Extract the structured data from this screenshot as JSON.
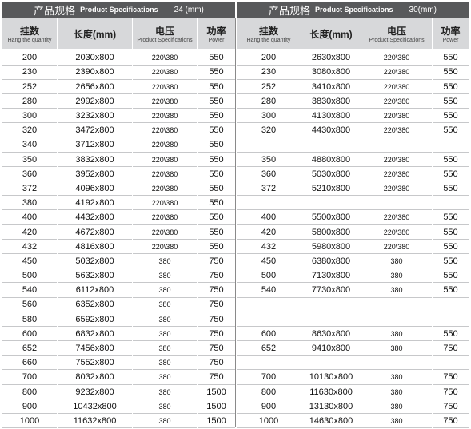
{
  "left": {
    "title_cn": "产品规格",
    "title_en": "Product Specifications",
    "title_size": "24 (mm)",
    "headers": [
      {
        "main": "挂数",
        "sub": "Hang the quantity"
      },
      {
        "main": "长度(mm)",
        "sub": ""
      },
      {
        "main": "电压",
        "sub": "Product Specifications"
      },
      {
        "main": "功率",
        "sub": "Power"
      }
    ],
    "rows": [
      [
        "200",
        "2030x800",
        "220\\380",
        "550"
      ],
      [
        "230",
        "2390x800",
        "220\\380",
        "550"
      ],
      [
        "252",
        "2656x800",
        "220\\380",
        "550"
      ],
      [
        "280",
        "2992x800",
        "220\\380",
        "550"
      ],
      [
        "300",
        "3232x800",
        "220\\380",
        "550"
      ],
      [
        "320",
        "3472x800",
        "220\\380",
        "550"
      ],
      [
        "340",
        "3712x800",
        "220\\380",
        "550"
      ],
      [
        "350",
        "3832x800",
        "220\\380",
        "550"
      ],
      [
        "360",
        "3952x800",
        "220\\380",
        "550"
      ],
      [
        "372",
        "4096x800",
        "220\\380",
        "550"
      ],
      [
        "380",
        "4192x800",
        "220\\380",
        "550"
      ],
      [
        "400",
        "4432x800",
        "220\\380",
        "550"
      ],
      [
        "420",
        "4672x800",
        "220\\380",
        "550"
      ],
      [
        "432",
        "4816x800",
        "220\\380",
        "550"
      ],
      [
        "450",
        "5032x800",
        "380",
        "750"
      ],
      [
        "500",
        "5632x800",
        "380",
        "750"
      ],
      [
        "540",
        "6112x800",
        "380",
        "750"
      ],
      [
        "560",
        "6352x800",
        "380",
        "750"
      ],
      [
        "580",
        "6592x800",
        "380",
        "750"
      ],
      [
        "600",
        "6832x800",
        "380",
        "750"
      ],
      [
        "652",
        "7456x800",
        "380",
        "750"
      ],
      [
        "660",
        "7552x800",
        "380",
        "750"
      ],
      [
        "700",
        "8032x800",
        "380",
        "750"
      ],
      [
        "800",
        "9232x800",
        "380",
        "1500"
      ],
      [
        "900",
        "10432x800",
        "380",
        "1500"
      ],
      [
        "1000",
        "11632x800",
        "380",
        "1500"
      ]
    ]
  },
  "right": {
    "title_cn": "产品规格",
    "title_en": "Product Specifications",
    "title_size": "30(mm)",
    "headers": [
      {
        "main": "挂数",
        "sub": "Hang the quantity"
      },
      {
        "main": "长度(mm)",
        "sub": ""
      },
      {
        "main": "电压",
        "sub": "Product Specifications"
      },
      {
        "main": "功率",
        "sub": "Power"
      }
    ],
    "rows": [
      [
        "200",
        "2630x800",
        "220\\380",
        "550"
      ],
      [
        "230",
        "3080x800",
        "220\\380",
        "550"
      ],
      [
        "252",
        "3410x800",
        "220\\380",
        "550"
      ],
      [
        "280",
        "3830x800",
        "220\\380",
        "550"
      ],
      [
        "300",
        "4130x800",
        "220\\380",
        "550"
      ],
      [
        "320",
        "4430x800",
        "220\\380",
        "550"
      ],
      [
        "",
        "",
        "",
        ""
      ],
      [
        "350",
        "4880x800",
        "220\\380",
        "550"
      ],
      [
        "360",
        "5030x800",
        "220\\380",
        "550"
      ],
      [
        "372",
        "5210x800",
        "220\\380",
        "550"
      ],
      [
        "",
        "",
        "",
        ""
      ],
      [
        "400",
        "5500x800",
        "220\\380",
        "550"
      ],
      [
        "420",
        "5800x800",
        "220\\380",
        "550"
      ],
      [
        "432",
        "5980x800",
        "220\\380",
        "550"
      ],
      [
        "450",
        "6380x800",
        "380",
        "550"
      ],
      [
        "500",
        "7130x800",
        "380",
        "550"
      ],
      [
        "540",
        "7730x800",
        "380",
        "550"
      ],
      [
        "",
        "",
        "",
        ""
      ],
      [
        "",
        "",
        "",
        ""
      ],
      [
        "600",
        "8630x800",
        "380",
        "550"
      ],
      [
        "652",
        "9410x800",
        "380",
        "750"
      ],
      [
        "",
        "",
        "",
        ""
      ],
      [
        "700",
        "10130x800",
        "380",
        "750"
      ],
      [
        "800",
        "11630x800",
        "380",
        "750"
      ],
      [
        "900",
        "13130x800",
        "380",
        "750"
      ],
      [
        "1000",
        "14630x800",
        "380",
        "750"
      ]
    ]
  }
}
